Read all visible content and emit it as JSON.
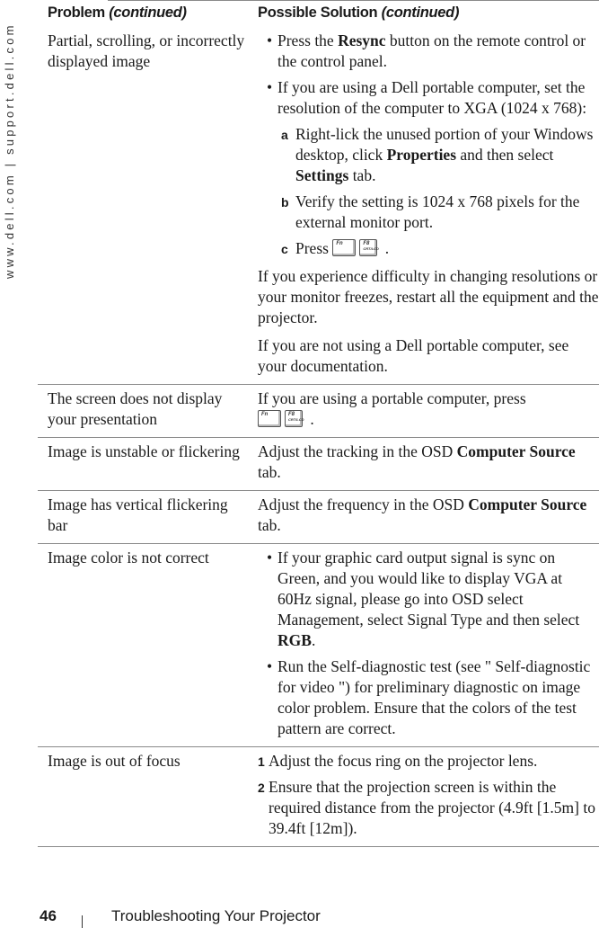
{
  "side_url": "www.dell.com | support.dell.com",
  "table": {
    "headers": {
      "problem": "Problem",
      "problem_suffix": "(continued)",
      "solution": "Possible Solution",
      "solution_suffix": "(continued)"
    },
    "rows": [
      {
        "problem": "Partial, scrolling, or incorrectly displayed image",
        "solution": {
          "bullet1": {
            "pre": "Press the ",
            "bold": "Resync",
            "post": " button on the remote control or the control panel."
          },
          "bullet2": "If you are using a Dell portable computer, set the resolution of the computer to XGA (1024 x 768):",
          "steps": [
            {
              "label": "a",
              "pre": "Right-lick the unused portion of your Windows desktop, click ",
              "bold1": "Properties",
              "mid": " and then select ",
              "bold2": "Settings",
              "post": " tab."
            },
            {
              "label": "b",
              "text": "Verify the setting is 1024 x 768 pixels for the external monitor port."
            },
            {
              "label": "c",
              "pre": "Press",
              "post": "."
            }
          ],
          "para1": "If you experience difficulty in changing resolutions or your monitor freezes, restart all the equipment and the projector.",
          "para2": "If you are not using a Dell portable computer, see your documentation."
        }
      },
      {
        "problem": "The screen does not display your presentation",
        "solution": {
          "pre": "If you are using a portable computer, press",
          "post": "."
        }
      },
      {
        "problem": "Image is unstable or flickering",
        "solution": {
          "pre": "Adjust the tracking in the OSD ",
          "bold": "Computer Source",
          "post": " tab."
        }
      },
      {
        "problem": "Image has vertical flickering bar",
        "solution": {
          "pre": "Adjust the frequency in the OSD ",
          "bold": "Computer Source",
          "post": " tab."
        }
      },
      {
        "problem": "Image color is not correct",
        "solution": {
          "bullet1": {
            "pre": "If your graphic card output signal is sync on Green, and you would like to display VGA at 60Hz signal, please go into OSD select Management, select Signal Type and then select ",
            "bold": "RGB",
            "post": "."
          },
          "bullet2": "Run the Self-diagnostic test (see \" Self-diagnostic for video \") for preliminary diagnostic on image color problem. Ensure that the colors of the test pattern are correct."
        }
      },
      {
        "problem": "Image is out of focus",
        "solution": {
          "steps": [
            {
              "label": "1",
              "text": "Adjust the focus ring on the projector lens."
            },
            {
              "label": "2",
              "text": "Ensure that the projection screen is within the required distance from the projector (4.9ft [1.5m] to 39.4ft [12m])."
            }
          ]
        }
      }
    ]
  },
  "keys": {
    "fn": "Fn",
    "f8_line1": "F8",
    "f8_line2": "CRT/LCD"
  },
  "bullet_glyph": "•",
  "footer": {
    "page_number": "46",
    "section_title": "Troubleshooting Your Projector"
  }
}
